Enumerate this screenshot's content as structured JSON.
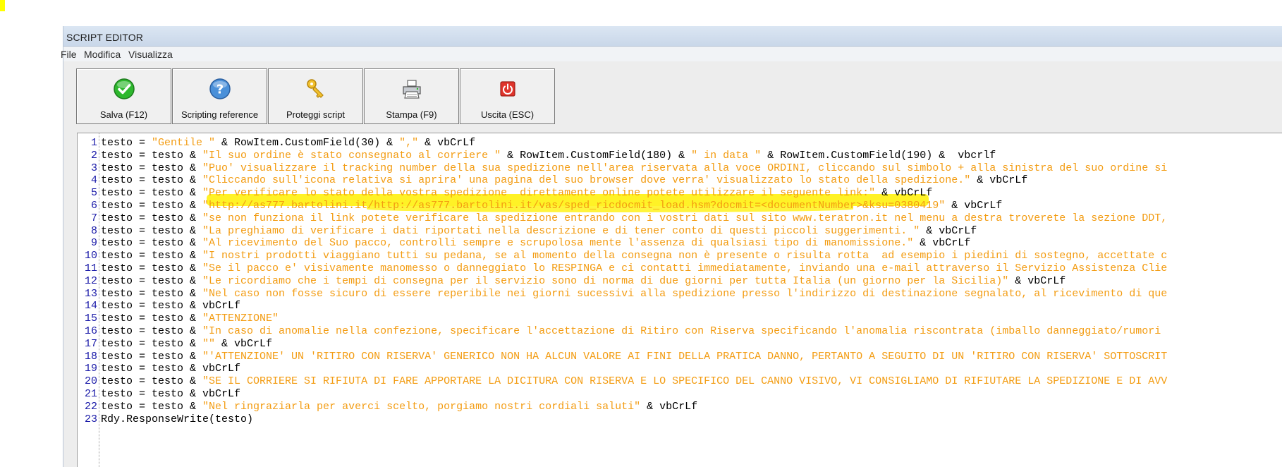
{
  "window": {
    "title": "SCRIPT EDITOR"
  },
  "menu": [
    {
      "label": "File"
    },
    {
      "label": "Modifica"
    },
    {
      "label": "Visualizza"
    }
  ],
  "toolbar": [
    {
      "label": "Salva (F12)",
      "icon": "check-icon"
    },
    {
      "label": "Scripting reference",
      "icon": "help-icon"
    },
    {
      "label": "Proteggi script",
      "icon": "key-icon"
    },
    {
      "label": "Stampa (F9)",
      "icon": "printer-icon"
    },
    {
      "label": "Uscita (ESC)",
      "icon": "exit-icon"
    }
  ],
  "colors": {
    "string": "#f39c12",
    "line_number": "#1a1aa8",
    "highlight": "#fff000"
  },
  "editor": {
    "lines": [
      {
        "n": "1",
        "parts": [
          [
            "testo = ",
            0
          ],
          [
            "\"Gentile \"",
            1
          ],
          [
            " & RowItem.CustomField(30) & ",
            0
          ],
          [
            "\",\"",
            1
          ],
          [
            " & vbCrLf",
            0
          ]
        ]
      },
      {
        "n": "2",
        "parts": [
          [
            "testo = testo & ",
            0
          ],
          [
            "\"Il suo ordine è stato consegnato al corriere \"",
            1
          ],
          [
            " & RowItem.CustomField(180) & ",
            0
          ],
          [
            "\" in data \"",
            1
          ],
          [
            " & RowItem.CustomField(190) &  vbcrlf",
            0
          ]
        ]
      },
      {
        "n": "3",
        "parts": [
          [
            "testo = testo & ",
            0
          ],
          [
            "\"Puo' visualizzare il tracking number della sua spedizione nell'area riservata alla voce ORDINI, cliccando sul simbolo + alla sinistra del suo ordine si",
            1
          ]
        ]
      },
      {
        "n": "4",
        "parts": [
          [
            "testo = testo & ",
            0
          ],
          [
            "\"Cliccando sull'icona relativa si aprira' una pagina del suo browser dove verra' visualizzato lo stato della spedizione.\"",
            1
          ],
          [
            " & vbCrLf",
            0
          ]
        ]
      },
      {
        "n": "5",
        "parts": [
          [
            "testo = testo & ",
            0
          ],
          [
            "\"Per verificare lo stato della vostra spedizione  direttamente online potete utilizzare il seguente link:\"",
            1
          ],
          [
            " & vbCrLf",
            0
          ]
        ]
      },
      {
        "n": "6",
        "parts": [
          [
            "testo = testo & ",
            0
          ],
          [
            "\"http://as777.bartolini.it/http://as777.bartolini.it/vas/sped_ricdocmit_load.hsm?docmit=<documentNumber>&ksu=0380419\"",
            1
          ],
          [
            " & vbCrLf",
            0
          ]
        ]
      },
      {
        "n": "7",
        "parts": [
          [
            "testo = testo & ",
            0
          ],
          [
            "\"se non funziona il link potete verificare la spedizione entrando con i vostri dati sul sito www.teratron.it nel menu a destra troverete la sezione DDT,",
            1
          ]
        ]
      },
      {
        "n": "8",
        "parts": [
          [
            "testo = testo & ",
            0
          ],
          [
            "\"La preghiamo di verificare i dati riportati nella descrizione e di tener conto di questi piccoli suggerimenti. \"",
            1
          ],
          [
            " & vbCrLf",
            0
          ]
        ]
      },
      {
        "n": "9",
        "parts": [
          [
            "testo = testo & ",
            0
          ],
          [
            "\"Al ricevimento del Suo pacco, controlli sempre e scrupolosa mente l'assenza di qualsiasi tipo di manomissione.\"",
            1
          ],
          [
            " & vbCrLf",
            0
          ]
        ]
      },
      {
        "n": "10",
        "parts": [
          [
            "testo = testo & ",
            0
          ],
          [
            "\"I nostri prodotti viaggiano tutti su pedana, se al momento della consegna non è presente o risulta rotta  ad esempio i piedini di sostegno, accettate c",
            1
          ]
        ]
      },
      {
        "n": "11",
        "parts": [
          [
            "testo = testo & ",
            0
          ],
          [
            "\"Se il pacco e' visivamente manomesso o danneggiato lo RESPINGA e ci contatti immediatamente, inviando una e-mail attraverso il Servizio Assistenza Clie",
            1
          ]
        ]
      },
      {
        "n": "12",
        "parts": [
          [
            "testo = testo & ",
            0
          ],
          [
            "\"Le ricordiamo che i tempi di consegna per il servizio sono di norma di due giorni per tutta Italia (un giorno per la Sicilia)\"",
            1
          ],
          [
            " & vbCrLf",
            0
          ]
        ]
      },
      {
        "n": "13",
        "parts": [
          [
            "testo = testo & ",
            0
          ],
          [
            "\"Nel caso non fosse sicuro di essere reperibile nei giorni sucessivi alla spedizione presso l'indirizzo di destinazione segnalato, al ricevimento di que",
            1
          ]
        ]
      },
      {
        "n": "14",
        "parts": [
          [
            "testo = testo & vbCrLf",
            0
          ]
        ]
      },
      {
        "n": "15",
        "parts": [
          [
            "testo = testo & ",
            0
          ],
          [
            "\"ATTENZIONE\"",
            1
          ]
        ]
      },
      {
        "n": "16",
        "parts": [
          [
            "testo = testo & ",
            0
          ],
          [
            "\"In caso di anomalie nella confezione, specificare l'accettazione di Ritiro con Riserva specificando l'anomalia riscontrata (imballo danneggiato/rumori",
            1
          ]
        ]
      },
      {
        "n": "17",
        "parts": [
          [
            "testo = testo & ",
            0
          ],
          [
            "\"\"",
            1
          ],
          [
            " & vbCrLf",
            0
          ]
        ]
      },
      {
        "n": "18",
        "parts": [
          [
            "testo = testo & ",
            0
          ],
          [
            "\"'ATTENZIONE' UN 'RITIRO CON RISERVA' GENERICO NON HA ALCUN VALORE AI FINI DELLA PRATICA DANNO, PERTANTO A SEGUITO DI UN 'RITIRO CON RISERVA' SOTTOSCRIT",
            1
          ]
        ]
      },
      {
        "n": "19",
        "parts": [
          [
            "testo = testo & vbCrLf",
            0
          ]
        ]
      },
      {
        "n": "20",
        "parts": [
          [
            "testo = testo & ",
            0
          ],
          [
            "\"SE IL CORRIERE SI RIFIUTA DI FARE APPORTARE LA DICITURA CON RISERVA E LO SPECIFICO DEL CANNO VISIVO, VI CONSIGLIAMO DI RIFIUTARE LA SPEDIZIONE E DI AVV",
            1
          ]
        ]
      },
      {
        "n": "21",
        "parts": [
          [
            "testo = testo & vbCrLf",
            0
          ]
        ]
      },
      {
        "n": "22",
        "parts": [
          [
            "testo = testo & ",
            0
          ],
          [
            "\"Nel ringraziarla per averci scelto, porgiamo nostri cordiali saluti\"",
            1
          ],
          [
            " & vbCrLf",
            0
          ]
        ]
      },
      {
        "n": "23",
        "parts": [
          [
            "Rdy.ResponseWrite(testo)",
            0
          ]
        ]
      }
    ]
  }
}
